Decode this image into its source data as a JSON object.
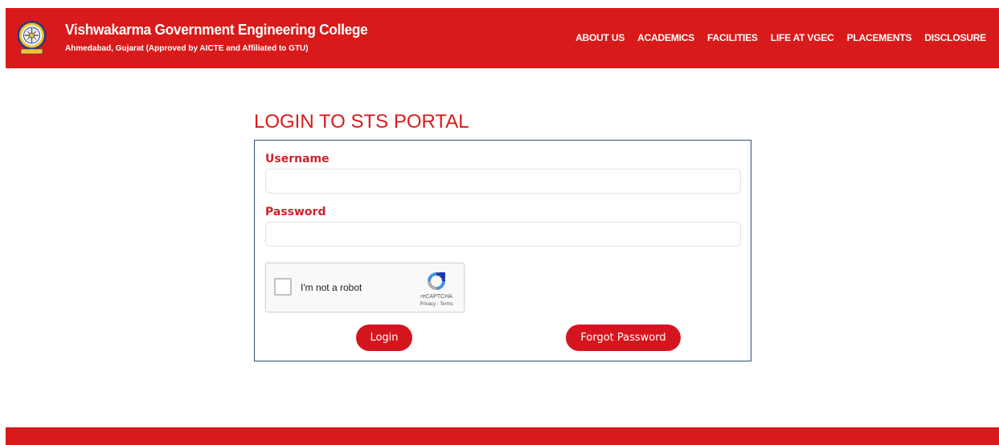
{
  "header": {
    "college_name": "Vishwakarma Government Engineering College",
    "college_subtitle": "Ahmedabad, Gujarat (Approved by AICTE and Affiliated to GTU)",
    "logo_icon": "college-emblem-icon",
    "nav": [
      {
        "label": "ABOUT US"
      },
      {
        "label": "ACADEMICS"
      },
      {
        "label": "FACILITIES"
      },
      {
        "label": "LIFE AT VGEC"
      },
      {
        "label": "PLACEMENTS"
      },
      {
        "label": "DISCLOSURE"
      }
    ]
  },
  "login": {
    "title": "LOGIN TO STS PORTAL",
    "username_label": "Username",
    "username_value": "",
    "password_label": "Password",
    "password_value": "",
    "login_button": "Login",
    "forgot_button": "Forgot Password"
  },
  "captcha": {
    "text": "I'm not a robot",
    "brand": "reCAPTCHA",
    "links": "Privacy - Terms",
    "checked": false,
    "icon": "recaptcha-icon"
  },
  "colors": {
    "brand_red": "#d91a1a",
    "label_red": "#c8262e",
    "card_border": "#2f4f75"
  }
}
